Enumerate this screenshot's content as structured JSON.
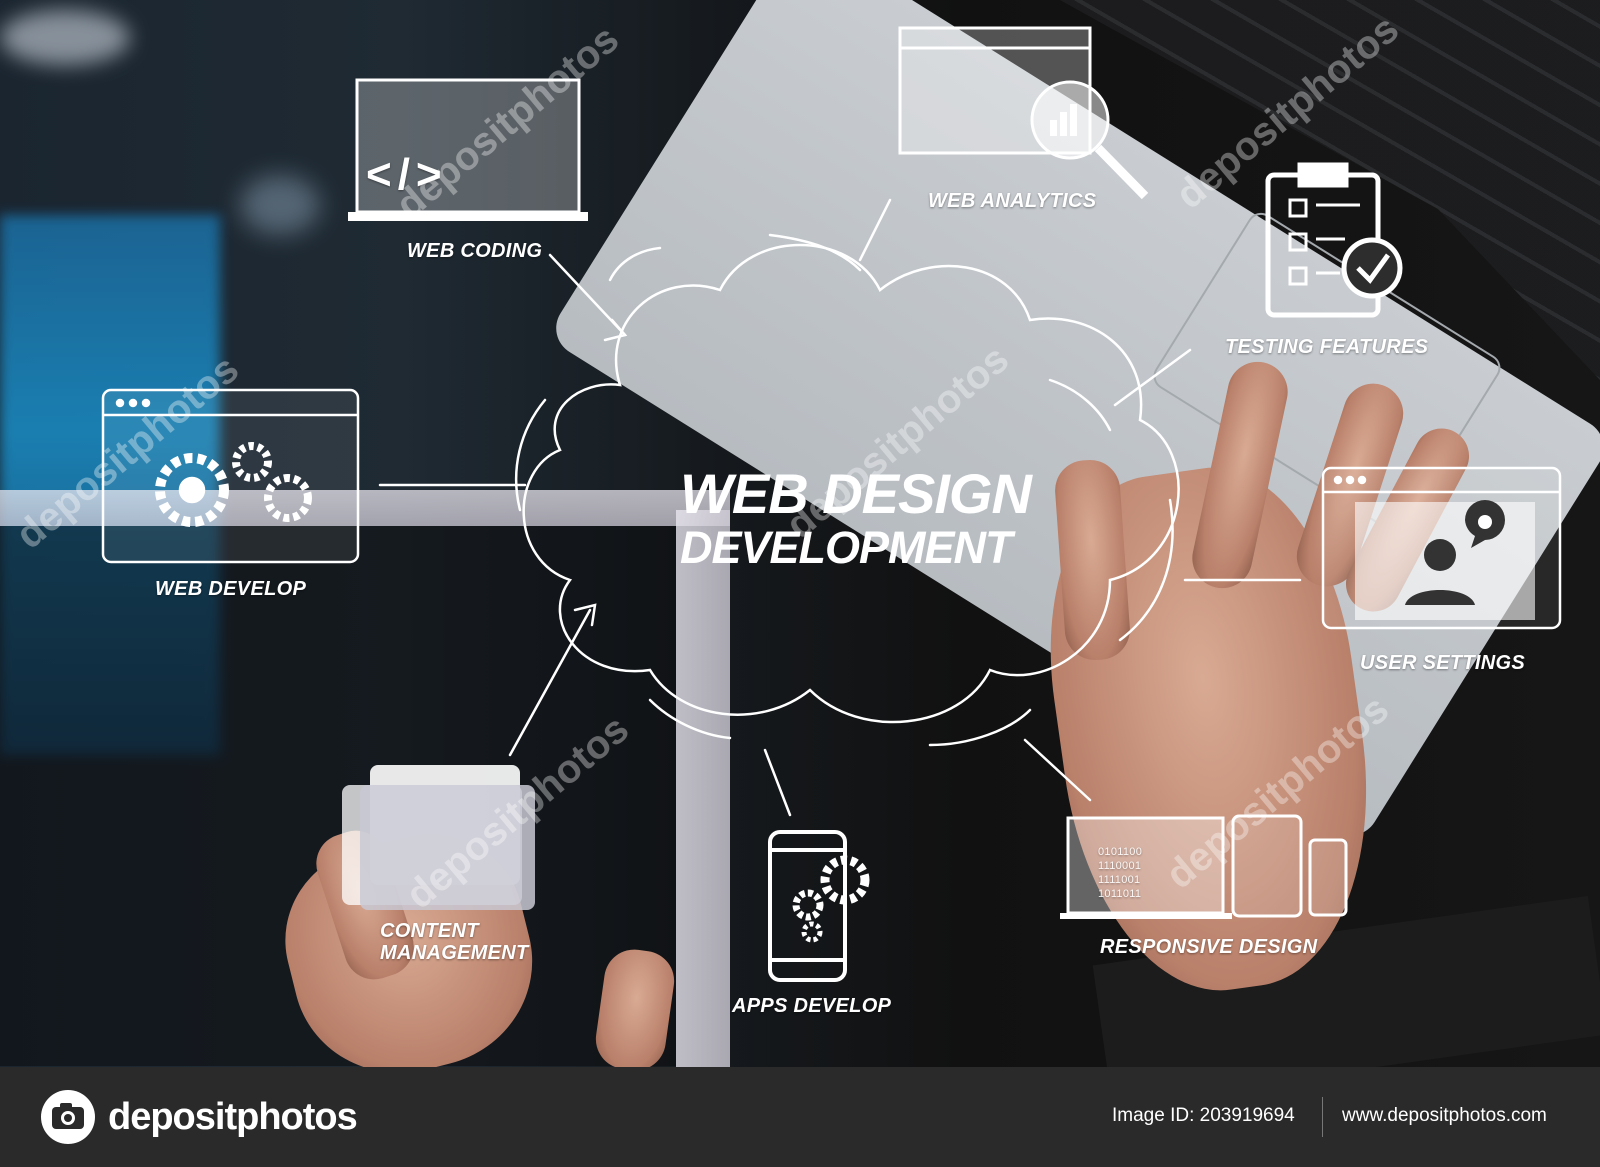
{
  "image": {
    "center_title_line1": "WEB DESIGN",
    "center_title_line2": "DEVELOPMENT",
    "nodes": {
      "web_coding": "WEB CODING",
      "web_analytics": "WEB ANALYTICS",
      "testing_features": "TESTING FEATURES",
      "web_develop": "WEB DEVELOP",
      "user_settings": "USER SETTINGS",
      "content_management_line1": "CONTENT",
      "content_management_line2": "MANAGEMENT",
      "apps_develop": "APPS DEVELOP",
      "responsive_design": "RESPONSIVE DESIGN"
    },
    "code_glyph": "</>",
    "binary_text": [
      "0101100",
      "1110001",
      "1111001",
      "1011011"
    ],
    "watermark_text": "depositphotos"
  },
  "footer": {
    "brand": "depositphotos",
    "image_id": "Image ID: 203919694",
    "site": "www.depositphotos.com"
  }
}
